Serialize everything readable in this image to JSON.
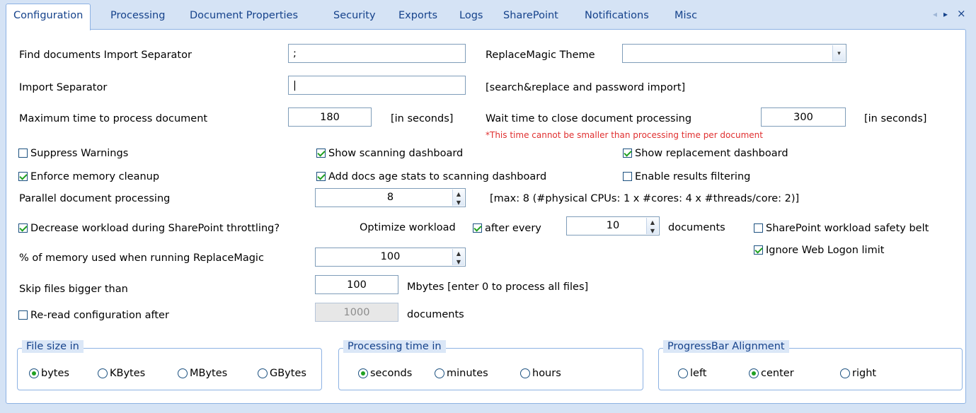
{
  "tabs": {
    "items": [
      "Configuration",
      "Processing",
      "Document Properties",
      "Security",
      "Exports",
      "Logs",
      "SharePoint",
      "Notifications",
      "Misc"
    ],
    "nav_prev": "◂",
    "nav_next": "▸",
    "close": "×"
  },
  "form": {
    "find_sep_label": "Find documents Import Separator",
    "find_sep_value": ";",
    "theme_label": "ReplaceMagic Theme",
    "theme_value": "",
    "import_sep_label": "Import Separator",
    "import_sep_value": "|",
    "import_sep_note": "[search&replace and password import]",
    "max_time_label": "Maximum time to process document",
    "max_time_value": "180",
    "max_time_unit": "[in seconds]",
    "wait_time_label": "Wait time to close document processing",
    "wait_time_value": "300",
    "wait_time_unit": "[in seconds]",
    "wait_time_warning": "*This time cannot be smaller than processing time per document",
    "suppress_warnings": "Suppress Warnings",
    "show_scanning_dashboard": "Show scanning dashboard",
    "show_replacement_dashboard": "Show replacement dashboard",
    "enforce_memory_cleanup": "Enforce memory cleanup",
    "add_docs_age_stats": "Add docs age stats to scanning dashboard",
    "enable_results_filtering": "Enable results filtering",
    "parallel_label": "Parallel document processing",
    "parallel_value": "8",
    "parallel_note": "[max: 8 (#physical CPUs: 1 x #cores: 4 x #threads/core: 2)]",
    "decrease_workload": "Decrease workload during SharePoint throttling?",
    "optimize_workload_label": "Optimize workload",
    "after_every": "after every",
    "after_every_value": "10",
    "documents_label": "documents",
    "sp_safety_belt": "SharePoint workload safety belt",
    "ignore_web_logon": "Ignore Web Logon limit",
    "memory_label": "% of memory used when running ReplaceMagic",
    "memory_value": "100",
    "skip_label": "Skip files bigger than",
    "skip_value": "100",
    "skip_note": "Mbytes [enter 0 to process all files]",
    "reread_label": "Re-read configuration after",
    "reread_value": "1000",
    "reread_unit": "documents"
  },
  "checkbox_state": {
    "suppress_warnings": false,
    "show_scanning_dashboard": true,
    "show_replacement_dashboard": true,
    "enforce_memory_cleanup": true,
    "add_docs_age_stats": true,
    "enable_results_filtering": false,
    "decrease_workload": true,
    "after_every": true,
    "sp_safety_belt": false,
    "ignore_web_logon": true,
    "reread": false
  },
  "groups": {
    "file_size": {
      "title": "File size in",
      "options": [
        "bytes",
        "KBytes",
        "MBytes",
        "GBytes"
      ],
      "selected": "bytes"
    },
    "processing_time": {
      "title": "Processing time in",
      "options": [
        "seconds",
        "minutes",
        "hours"
      ],
      "selected": "seconds"
    },
    "progressbar": {
      "title": "ProgressBar Alignment",
      "options": [
        "left",
        "center",
        "right"
      ],
      "selected": "center"
    }
  },
  "colors": {
    "tab_text": "#15428b",
    "border": "#8db2e3",
    "check_green": "#21a121",
    "warning_red": "#e03030",
    "background": "#d5e3f5"
  }
}
